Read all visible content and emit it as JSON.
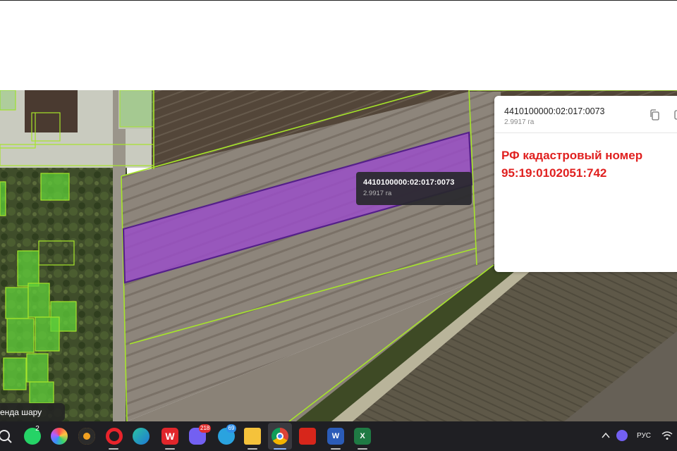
{
  "selection_tooltip": {
    "cadastral_number": "4410100000:02:017:0073",
    "area": "2.9917 га"
  },
  "info_panel": {
    "cadastral_number": "4410100000:02:017:0073",
    "area": "2.9917 га",
    "copy_icon": "copy-icon",
    "rf_label": "РФ кадастровый номер",
    "rf_number": "95:19:0102051:742"
  },
  "map_chip": {
    "label": "енда шару"
  },
  "colors": {
    "parcel_fill": "#9b4dca",
    "parcel_outline": "#55208a",
    "boundary_line": "#a6e52a",
    "rf_text": "#e0201f"
  },
  "taskbar": {
    "icons": [
      {
        "name": "search-icon"
      },
      {
        "name": "whatsapp-icon",
        "badge": "2"
      },
      {
        "name": "pinwheel-app-icon"
      },
      {
        "name": "eye-app-icon"
      },
      {
        "name": "opera-icon"
      },
      {
        "name": "edge-icon"
      },
      {
        "name": "wps-office-icon"
      },
      {
        "name": "viber-icon",
        "badge": "218"
      },
      {
        "name": "telegram-icon",
        "badge": "69"
      },
      {
        "name": "file-explorer-icon"
      },
      {
        "name": "chrome-icon"
      },
      {
        "name": "acrobat-icon"
      },
      {
        "name": "word-icon"
      },
      {
        "name": "excel-icon"
      }
    ],
    "tray": {
      "chevron_icon": "chevron-up-icon",
      "viber_tray_icon": "viber-tray-icon",
      "language": "РУС",
      "wifi_icon": "wifi-icon"
    }
  }
}
